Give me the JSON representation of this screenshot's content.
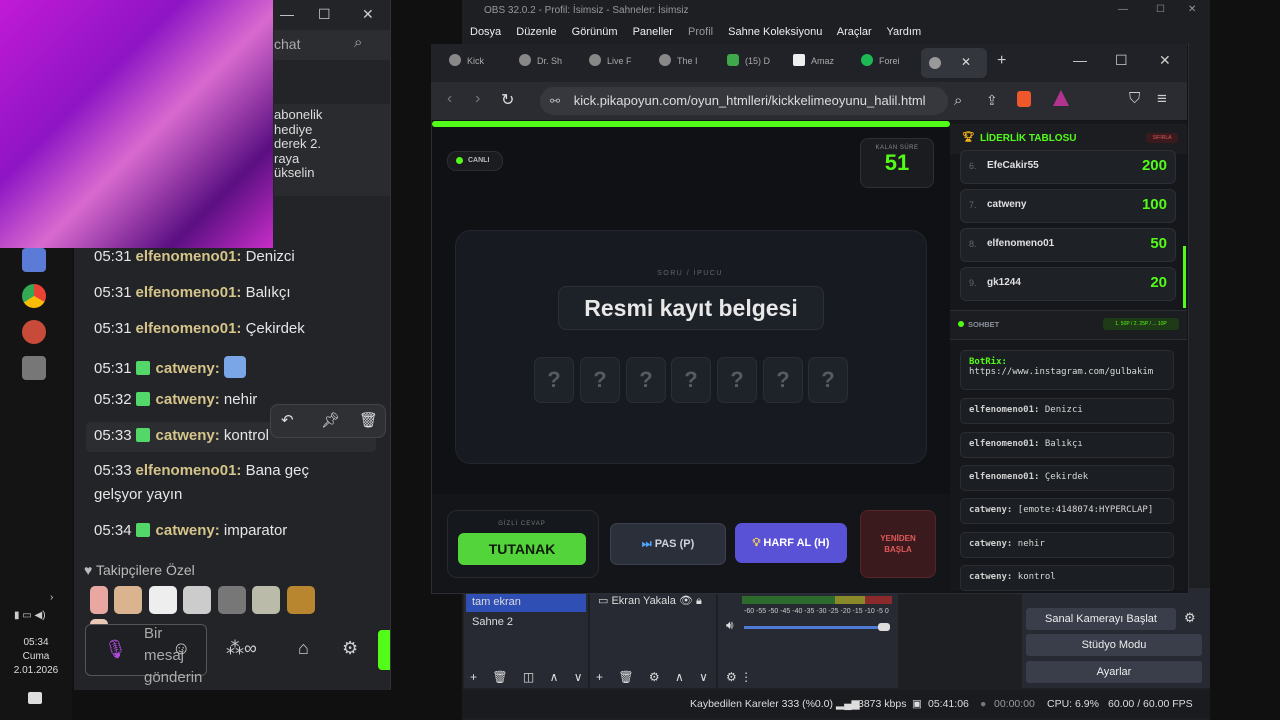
{
  "clock": {
    "time": "05:34",
    "day": "Cuma",
    "date": "2.01.2026"
  },
  "chat_panel": {
    "search_label": "chat",
    "notice_lines": [
      "abonelik",
      "hediye",
      "derek 2.",
      "raya",
      "ükselin"
    ],
    "messages": [
      {
        "time": "05:31",
        "user": "elfenomeno01:",
        "text": "Denizci"
      },
      {
        "time": "05:31",
        "user": "elfenomeno01:",
        "text": "Balıkçı"
      },
      {
        "time": "05:31",
        "user": "elfenomeno01:",
        "text": "Çekirdek"
      },
      {
        "time": "05:31",
        "user": "catweny:",
        "text": ""
      },
      {
        "time": "05:32",
        "user": "catweny:",
        "text": "nehir"
      },
      {
        "time": "05:33",
        "user": "catweny:",
        "text": "kontrol"
      },
      {
        "time": "05:33",
        "user": "elfenomeno01:",
        "text": "Bana geç"
      },
      {
        "time": "05:34",
        "user": "catweny:",
        "text": "imparator"
      }
    ],
    "message_wrap": "gelşyor yayın",
    "followers_label": "Takipçilere Özel",
    "input_placeholder": "Bir mesaj gönderin"
  },
  "obs": {
    "title": "OBS 32.0.2 - Profil: İsimsiz - Sahneler: İsimsiz",
    "menu": [
      "Dosya",
      "Düzenle",
      "Görünüm",
      "Paneller",
      "Profil",
      "Sahne Koleksiyonu",
      "Araçlar",
      "Yardım"
    ],
    "scenes": [
      "tam ekran",
      "Sahne 2"
    ],
    "source": "Ekran Yakala",
    "meter_ticks": "-60 -55 -50 -45 -40 -35 -30 -25 -20 -15 -10 -5 0",
    "controls": [
      "Sanal Kamerayı Başlat",
      "Stüdyo Modu",
      "Ayarlar"
    ],
    "status": {
      "dropped": "Kaybedilen Kareler 333 (%0.0)",
      "bitrate": "3873 kbps",
      "live_time": "05:41:06",
      "rec_time": "00:00:00",
      "cpu": "CPU: 6.9%",
      "fps": "60.00 / 60.00 FPS"
    }
  },
  "browser": {
    "tabs": [
      "Kick",
      "Dr. Sh",
      "Live F",
      "The I",
      "(15) D",
      "Amaz",
      "Forei"
    ],
    "url": "kick.pikapoyun.com/oyun_htmlleri/kickkelimeoyunu_halil.html"
  },
  "game": {
    "live_label": "CANLI",
    "timer_label": "KALAN SÜRE",
    "timer_value": "51",
    "question_label": "SORU / İPUCU",
    "question_text": "Resmi kayıt belgesi",
    "slots": [
      "?",
      "?",
      "?",
      "?",
      "?",
      "?",
      "?"
    ],
    "answer_label": "GİZLİ CEVAP",
    "answer_value": "TUTANAK",
    "pass_label": "PAS (P)",
    "hint_label": "HARF AL (H)",
    "restart_line1": "YENİDEN",
    "restart_line2": "BAŞLA"
  },
  "leaderboard": {
    "title": "LİDERLİK TABLOSU",
    "clear_label": "SIFIRLA",
    "rows": [
      {
        "rank": "6.",
        "name": "EfeCakir55",
        "score": "200"
      },
      {
        "rank": "7.",
        "name": "catweny",
        "score": "100"
      },
      {
        "rank": "8.",
        "name": "elfenomeno01",
        "score": "50"
      },
      {
        "rank": "9.",
        "name": "gk1244",
        "score": "20"
      }
    ]
  },
  "game_chat": {
    "title": "SOHBET",
    "stakes": "1. 50P / 2. 25P / ... 10P",
    "messages": [
      {
        "user": "BotRix:",
        "text": "https://www.instagram.com/gulbakim"
      },
      {
        "user": "elfenomeno01:",
        "text": "Denizci"
      },
      {
        "user": "elfenomeno01:",
        "text": "Balıkçı"
      },
      {
        "user": "elfenomeno01:",
        "text": "Çekirdek"
      },
      {
        "user": "catweny:",
        "text": "[emote:4148074:HYPERCLAP]"
      },
      {
        "user": "catweny:",
        "text": "nehir"
      },
      {
        "user": "catweny:",
        "text": "kontrol"
      }
    ]
  },
  "colors": {
    "kick_green": "#53fc18",
    "hint_purple": "#5a52d6",
    "restart_red": "#e05a5a"
  }
}
